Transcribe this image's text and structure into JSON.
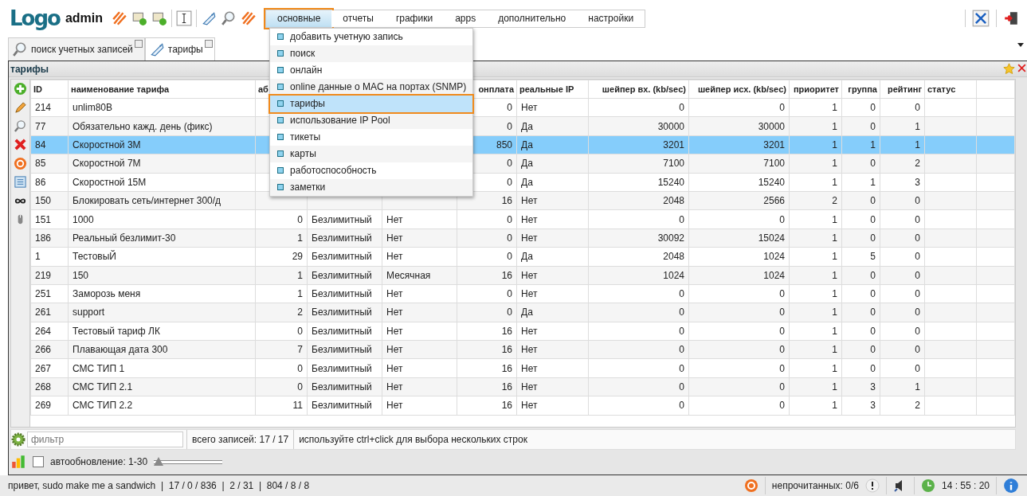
{
  "header": {
    "logo": "Logo",
    "user": "admin"
  },
  "nav": [
    {
      "label": "основные",
      "selected": true
    },
    {
      "label": "отчеты",
      "selected": false
    },
    {
      "label": "графики",
      "selected": false
    },
    {
      "label": "apps",
      "selected": false
    },
    {
      "label": "дополнительно",
      "selected": false
    },
    {
      "label": "настройки",
      "selected": false
    }
  ],
  "dropdown": [
    {
      "label": "добавить учетную запись",
      "selected": false
    },
    {
      "label": "поиск",
      "selected": false
    },
    {
      "label": "онлайн",
      "selected": false
    },
    {
      "label": "online данные о MAC на портах (SNMP)",
      "selected": false
    },
    {
      "label": "тарифы",
      "selected": true
    },
    {
      "label": "использование IP Pool",
      "selected": false
    },
    {
      "label": "тикеты",
      "selected": false
    },
    {
      "label": "карты",
      "selected": false
    },
    {
      "label": "работоспособность",
      "selected": false
    },
    {
      "label": "заметки",
      "selected": false
    }
  ],
  "tabs": [
    {
      "label": "поиск учетных записей",
      "selected": false
    },
    {
      "label": "тарифы",
      "selected": true
    }
  ],
  "panel": {
    "title": "тарифы"
  },
  "table": {
    "columns": [
      "ID",
      "наименование тарифа",
      "аб",
      null,
      null,
      "онплата",
      "реальные IP",
      "шейпер вх. (kb/sec)",
      "шейпер исх. (kb/sec)",
      "приоритет",
      "группа",
      "рейтинг",
      "статус",
      null
    ],
    "rows": [
      {
        "selected": false,
        "cells": [
          "214",
          "unlim80B",
          null,
          null,
          null,
          "0",
          "Нет",
          "0",
          "0",
          "1",
          "0",
          "0",
          null,
          null
        ]
      },
      {
        "selected": false,
        "cells": [
          "77",
          "Обязательно кажд. день (фикс)",
          null,
          null,
          null,
          "0",
          "Да",
          "30000",
          "30000",
          "1",
          "0",
          "1",
          null,
          null
        ]
      },
      {
        "selected": true,
        "cells": [
          "84",
          "Скоростной 3М",
          null,
          null,
          null,
          "850",
          "Да",
          "3201",
          "3201",
          "1",
          "1",
          "1",
          null,
          null
        ]
      },
      {
        "selected": false,
        "cells": [
          "85",
          "Скоростной 7М",
          null,
          null,
          null,
          "0",
          "Да",
          "7100",
          "7100",
          "1",
          "0",
          "2",
          null,
          null
        ]
      },
      {
        "selected": false,
        "cells": [
          "86",
          "Скоростной 15М",
          null,
          null,
          null,
          "0",
          "Да",
          "15240",
          "15240",
          "1",
          "1",
          "3",
          null,
          null
        ]
      },
      {
        "selected": false,
        "cells": [
          "150",
          "Блокировать сеть/интернет 300/д",
          null,
          null,
          null,
          "16",
          "Нет",
          "2048",
          "2566",
          "2",
          "0",
          "0",
          null,
          null
        ]
      },
      {
        "selected": false,
        "cells": [
          "151",
          "1000",
          "0",
          "Безлимитный",
          "Нет",
          "0",
          "Нет",
          "0",
          "0",
          "1",
          "0",
          "0",
          null,
          null
        ]
      },
      {
        "selected": false,
        "cells": [
          "186",
          "Реальный безлимит-30",
          "1",
          "Безлимитный",
          "Нет",
          "0",
          "Нет",
          "30092",
          "15024",
          "1",
          "0",
          "0",
          null,
          null
        ]
      },
      {
        "selected": false,
        "cells": [
          "1",
          "ТестовыЙ",
          "29",
          "Безлимитный",
          "Нет",
          "0",
          "Да",
          "2048",
          "1024",
          "1",
          "5",
          "0",
          null,
          null
        ]
      },
      {
        "selected": false,
        "cells": [
          "219",
          "150",
          "1",
          "Безлимитный",
          "Месячная",
          "16",
          "Нет",
          "1024",
          "1024",
          "1",
          "0",
          "0",
          null,
          null
        ]
      },
      {
        "selected": false,
        "cells": [
          "251",
          "Заморозь меня",
          "1",
          "Безлимитный",
          "Нет",
          "0",
          "Нет",
          "0",
          "0",
          "1",
          "0",
          "0",
          null,
          null
        ]
      },
      {
        "selected": false,
        "cells": [
          "261",
          "support",
          "2",
          "Безлимитный",
          "Нет",
          "0",
          "Да",
          "0",
          "0",
          "1",
          "0",
          "0",
          null,
          null
        ]
      },
      {
        "selected": false,
        "cells": [
          "264",
          "Тестовый тариф ЛК",
          "0",
          "Безлимитный",
          "Нет",
          "16",
          "Нет",
          "0",
          "0",
          "1",
          "0",
          "0",
          null,
          null
        ]
      },
      {
        "selected": false,
        "cells": [
          "266",
          "Плавающая дата 300",
          "7",
          "Безлимитный",
          "Нет",
          "16",
          "Нет",
          "0",
          "0",
          "1",
          "0",
          "0",
          null,
          null
        ]
      },
      {
        "selected": false,
        "cells": [
          "267",
          "СМС ТИП 1",
          "0",
          "Безлимитный",
          "Нет",
          "16",
          "Нет",
          "0",
          "0",
          "1",
          "0",
          "0",
          null,
          null
        ]
      },
      {
        "selected": false,
        "cells": [
          "268",
          "СМС ТИП 2.1",
          "0",
          "Безлимитный",
          "Нет",
          "16",
          "Нет",
          "0",
          "0",
          "1",
          "3",
          "1",
          null,
          null
        ]
      },
      {
        "selected": false,
        "cells": [
          "269",
          "СМС ТИП 2.2",
          "11",
          "Безлимитный",
          "Нет",
          "16",
          "Нет",
          "0",
          "0",
          "1",
          "3",
          "2",
          null,
          null
        ]
      }
    ]
  },
  "filter": {
    "placeholder": "фильтр",
    "total": "всего записей: 17 / 17",
    "hint": "используйте ctrl+click для выбора нескольких строк"
  },
  "autorefresh": {
    "checked": false,
    "label": "автообновление: 1-30",
    "level": 0
  },
  "status_bar": {
    "greeting": "привет, sudo make me a sandwich  |  17 / 0 / 836  |  2 / 31  |  804 / 8 / 8",
    "unread": "непрочитанных: 0/6",
    "time": "14 : 55 : 20"
  }
}
